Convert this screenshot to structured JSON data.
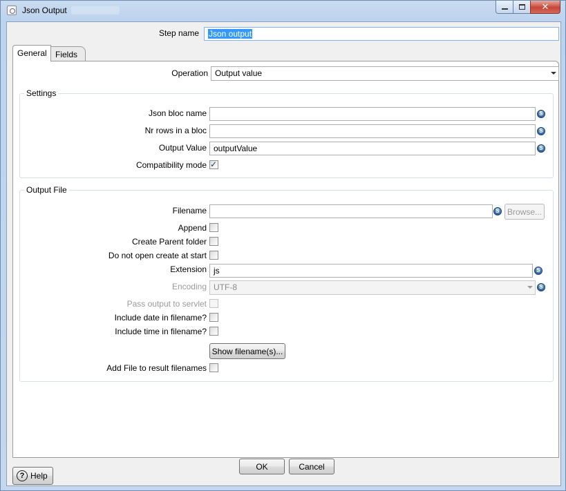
{
  "window": {
    "title": "Json Output",
    "controls": {
      "minimize": "minimize",
      "maximize": "maximize",
      "close": "✕"
    }
  },
  "step": {
    "label": "Step name",
    "value": "Json output"
  },
  "tabs": [
    {
      "label": "General"
    },
    {
      "label": "Fields"
    }
  ],
  "general": {
    "operation": {
      "label": "Operation",
      "value": "Output value"
    },
    "settings": {
      "title": "Settings",
      "json_bloc_name": {
        "label": "Json bloc name",
        "value": ""
      },
      "nr_rows": {
        "label": "Nr rows in a bloc",
        "value": ""
      },
      "output_value": {
        "label": "Output Value",
        "value": "outputValue"
      },
      "compatibility": {
        "label": "Compatibility mode",
        "checked": true
      }
    },
    "output_file": {
      "title": "Output File",
      "filename": {
        "label": "Filename",
        "value": "",
        "browse": "Browse..."
      },
      "append": {
        "label": "Append",
        "checked": false
      },
      "create_parent": {
        "label": "Create Parent folder",
        "checked": false
      },
      "do_not_open": {
        "label": "Do not open create at start",
        "checked": false
      },
      "extension": {
        "label": "Extension",
        "value": "js"
      },
      "encoding": {
        "label": "Encoding",
        "value": "UTF-8"
      },
      "pass_output": {
        "label": "Pass output to servlet",
        "checked": false
      },
      "include_date": {
        "label": "Include date in filename?",
        "checked": false
      },
      "include_time": {
        "label": "Include time in filename?",
        "checked": false
      },
      "show_filenames": "Show filename(s)...",
      "add_to_result": {
        "label": "Add File to result filenames",
        "checked": false
      }
    }
  },
  "footer": {
    "ok": "OK",
    "cancel": "Cancel",
    "help": "Help"
  },
  "icons": {
    "variable": "S",
    "check": "✓",
    "help": "?"
  }
}
